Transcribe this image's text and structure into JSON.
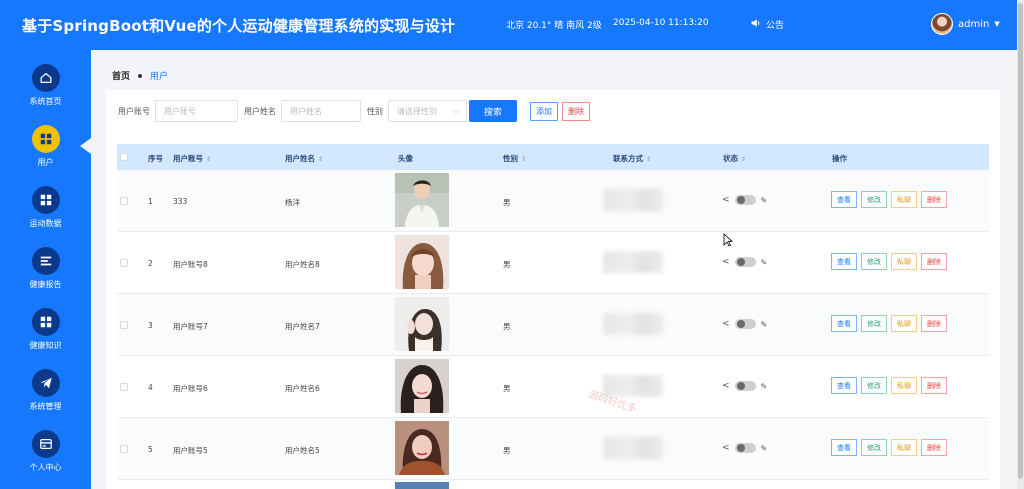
{
  "header": {
    "title": "基于SpringBoot和Vue的个人运动健康管理系统的实现与设计",
    "weather": "北京 20.1° 晴 南风 2级",
    "datetime": "2025-04-10 11:13:20",
    "notice": "公告",
    "username": "admin"
  },
  "sidebar": {
    "items": [
      {
        "label": "系统首页",
        "icon": "home-icon"
      },
      {
        "label": "用户",
        "icon": "grid-icon",
        "active": true
      },
      {
        "label": "运动数据",
        "icon": "grid-icon"
      },
      {
        "label": "健康报告",
        "icon": "list-icon"
      },
      {
        "label": "健康知识",
        "icon": "grid-icon"
      },
      {
        "label": "系统管理",
        "icon": "paper-plane-icon"
      },
      {
        "label": "个人中心",
        "icon": "card-icon"
      }
    ]
  },
  "breadcrumb": {
    "home": "首页",
    "current": "用户"
  },
  "filters": {
    "account_label": "用户账号",
    "account_placeholder": "用户账号",
    "name_label": "用户姓名",
    "name_placeholder": "用户姓名",
    "gender_label": "性别",
    "gender_placeholder": "请选择性别",
    "search_button": "搜索",
    "add_button": "添加",
    "delete_button": "删除"
  },
  "table": {
    "columns": [
      "序号",
      "用户账号",
      "用户姓名",
      "头像",
      "性别",
      "联系方式",
      "状态",
      "操作"
    ],
    "actions": {
      "view": "查看",
      "edit": "修改",
      "chat": "私聊",
      "delete": "删除"
    },
    "rows": [
      {
        "index": "1",
        "account": "333",
        "name": "杨洋",
        "gender": "男"
      },
      {
        "index": "2",
        "account": "用户账号8",
        "name": "用户姓名8",
        "gender": "男"
      },
      {
        "index": "3",
        "account": "用户账号7",
        "name": "用户姓名7",
        "gender": "男"
      },
      {
        "index": "4",
        "account": "用户账号6",
        "name": "用户姓名6",
        "gender": "男"
      },
      {
        "index": "5",
        "account": "用户账号5",
        "name": "用户姓名5",
        "gender": "男"
      }
    ]
  },
  "watermark": "源码好优多"
}
